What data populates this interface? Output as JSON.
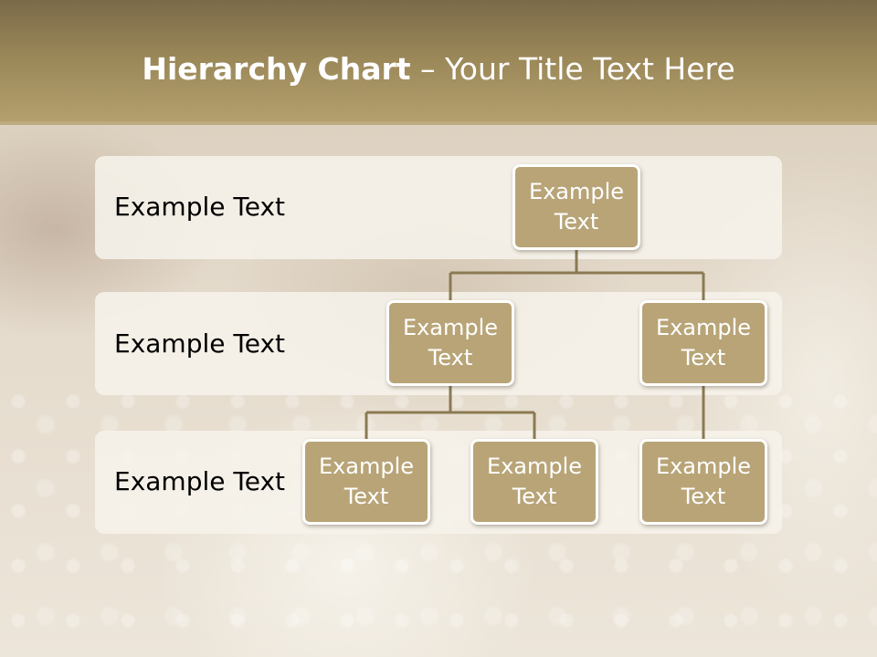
{
  "slide": {
    "title_bold": "Hierarchy Chart",
    "title_rest": " – Your Title Text Here"
  },
  "levels": [
    {
      "label": "Example Text"
    },
    {
      "label": "Example Text"
    },
    {
      "label": "Example Text"
    }
  ],
  "nodes": {
    "root": {
      "text": "Example Text"
    },
    "level2_left": {
      "text": "Example Text"
    },
    "level2_right": {
      "text": "Example Text"
    },
    "level3_a": {
      "text": "Example Text"
    },
    "level3_b": {
      "text": "Example Text"
    },
    "level3_c": {
      "text": "Example Text"
    }
  },
  "colors": {
    "header": "#9a8758",
    "node_fill": "#b8a477",
    "node_border": "#ffffff",
    "connector": "#8b7a52",
    "band": "#f6f2eb"
  }
}
